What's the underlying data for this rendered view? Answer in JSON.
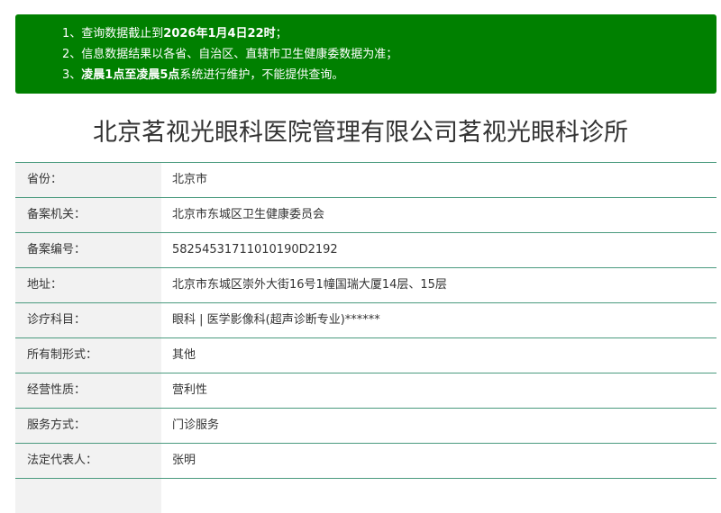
{
  "notice": {
    "line1": {
      "prefix": "1、查询数据截止到",
      "bold": "2026年1月4日22时",
      "suffix": "；"
    },
    "line2": {
      "text": "2、信息数据结果以各省、自治区、直辖市卫生健康委数据为准；"
    },
    "line3": {
      "prefix": "3、",
      "bold": "凌晨1点至凌晨5点",
      "suffix": "系统进行维护，不能提供查询。"
    }
  },
  "title": "北京茗视光眼科医院管理有限公司茗视光眼科诊所",
  "rows": [
    {
      "label": "省份：",
      "value": "北京市"
    },
    {
      "label": "备案机关：",
      "value": "北京市东城区卫生健康委员会"
    },
    {
      "label": "备案编号：",
      "value": "58254531711010190D2192"
    },
    {
      "label": "地址：",
      "value": "北京市东城区崇外大街16号1幢国瑞大厦14层、15层"
    },
    {
      "label": "诊疗科目：",
      "value": "眼科 | 医学影像科(超声诊断专业)******"
    },
    {
      "label": "所有制形式：",
      "value": "其他"
    },
    {
      "label": "经营性质：",
      "value": "营利性"
    },
    {
      "label": "服务方式：",
      "value": "门诊服务"
    },
    {
      "label": "法定代表人：",
      "value": "张明"
    }
  ],
  "colors": {
    "notice_bg": "#008000",
    "label_bg": "#f2f2f2",
    "row_border": "#4a9a7e"
  }
}
